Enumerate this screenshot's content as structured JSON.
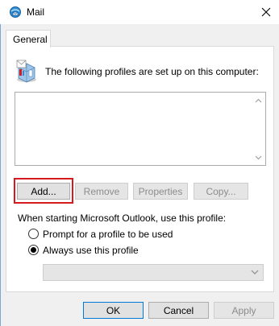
{
  "window": {
    "title": "Mail",
    "title_icon": "mail-setup-icon",
    "close_icon": "close-icon"
  },
  "tabs": [
    {
      "label": "General",
      "selected": true
    }
  ],
  "profiles": {
    "label": "The following profiles are set up on this computer:",
    "icon": "mail-profiles-icon",
    "items": []
  },
  "buttons": {
    "add": "Add...",
    "remove": "Remove",
    "properties": "Properties",
    "copy": "Copy..."
  },
  "startup": {
    "label": "When starting Microsoft Outlook, use this profile:",
    "options": [
      {
        "label": "Prompt for a profile to be used",
        "selected": false
      },
      {
        "label": "Always use this profile",
        "selected": true
      }
    ],
    "profile_select_value": ""
  },
  "footer": {
    "ok": "OK",
    "cancel": "Cancel",
    "apply": "Apply"
  },
  "colors": {
    "highlight": "#d6191c",
    "default_button_border": "#0078d7"
  }
}
